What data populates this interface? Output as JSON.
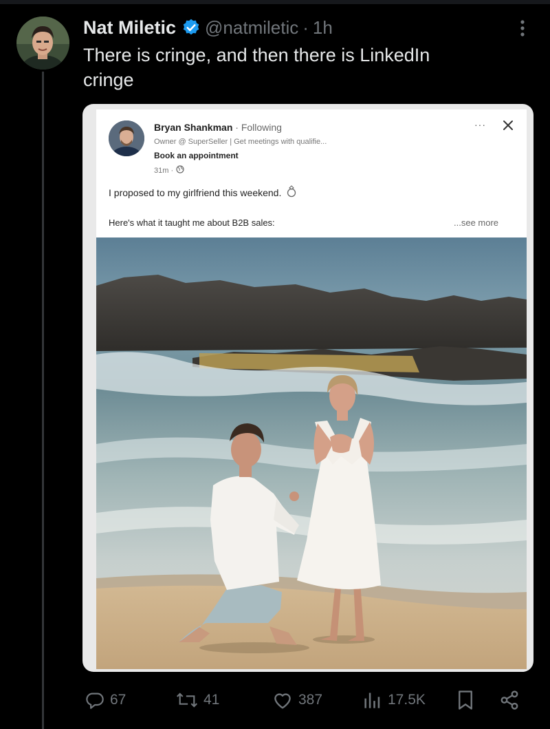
{
  "tweet": {
    "author_name": "Nat Miletic",
    "handle": "@natmiletic",
    "separator": "·",
    "time": "1h",
    "text": "There is cringe, and then there is LinkedIn\ncringe"
  },
  "linkedin_post": {
    "author_name": "Bryan Shankman",
    "follow_status": "· Following",
    "headline": "Owner @ SuperSeller | Get meetings with qualifie...",
    "cta": "Book an appointment",
    "time": "31m ·",
    "text_line1": "I proposed to my girlfriend this weekend.",
    "text_line2": "Here's what it taught me about B2B sales:",
    "see_more": "...see more",
    "menu_dots": "···"
  },
  "actions": {
    "replies": "67",
    "reposts": "41",
    "likes": "387",
    "views": "17.5K"
  },
  "colors": {
    "background": "#000000",
    "text_primary": "#e7e9ea",
    "text_secondary": "#71767b",
    "verified_blue": "#1d9bf0"
  },
  "icons": [
    "verified-badge-icon",
    "more-options-icon",
    "close-icon",
    "globe-icon",
    "ring-icon",
    "reply-icon",
    "repost-icon",
    "like-icon",
    "views-icon",
    "bookmark-icon",
    "share-icon"
  ]
}
